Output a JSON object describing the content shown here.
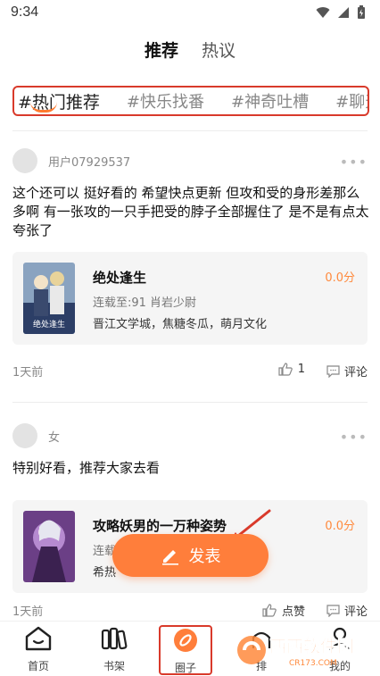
{
  "status_bar": {
    "time": "9:34"
  },
  "top_tabs": [
    {
      "label": "推荐",
      "active": true
    },
    {
      "label": "热议",
      "active": false
    }
  ],
  "tags": [
    {
      "label": "#热门推荐",
      "active": true
    },
    {
      "label": "#快乐找番",
      "active": false
    },
    {
      "label": "#神奇吐槽",
      "active": false
    },
    {
      "label": "#聊天",
      "active": false
    }
  ],
  "posts": [
    {
      "username": "用户07929537",
      "text": "这个还可以 挺好看的 希望快点更新 但攻和受的身形差那么多啊 有一张攻的一只手把受的脖子全部握住了 是不是有点太夸张了",
      "book": {
        "title": "绝处逢生",
        "latest": "连载至:91 肖岩少尉",
        "tags": "晋江文学城，焦糖冬瓜，萌月文化",
        "score": "0.0分",
        "cover_text": "绝处逢生"
      },
      "time": "1天前",
      "like_count": "1",
      "comment_label": "评论"
    },
    {
      "username": "女",
      "text": "特别好看，推荐大家去看",
      "book": {
        "title": "攻略妖男的一万种姿势",
        "latest": "连载至",
        "tags": "希热",
        "score": "0.0分"
      },
      "time": "1天前",
      "like_label": "点赞",
      "comment_label": "评论"
    }
  ],
  "fab": {
    "label": "发表"
  },
  "bottom_nav": [
    {
      "label": "首页",
      "icon": "home-icon"
    },
    {
      "label": "书架",
      "icon": "bookshelf-icon"
    },
    {
      "label": "圈子",
      "icon": "compass-icon",
      "active": true
    },
    {
      "label": "排",
      "icon": "rank-icon"
    },
    {
      "label": "我的",
      "icon": "profile-icon"
    }
  ],
  "watermark": {
    "text": "西西软件园",
    "sub": "CR173.COM"
  },
  "colors": {
    "accent": "#ff7e3b",
    "annotation": "#d93a2b"
  }
}
